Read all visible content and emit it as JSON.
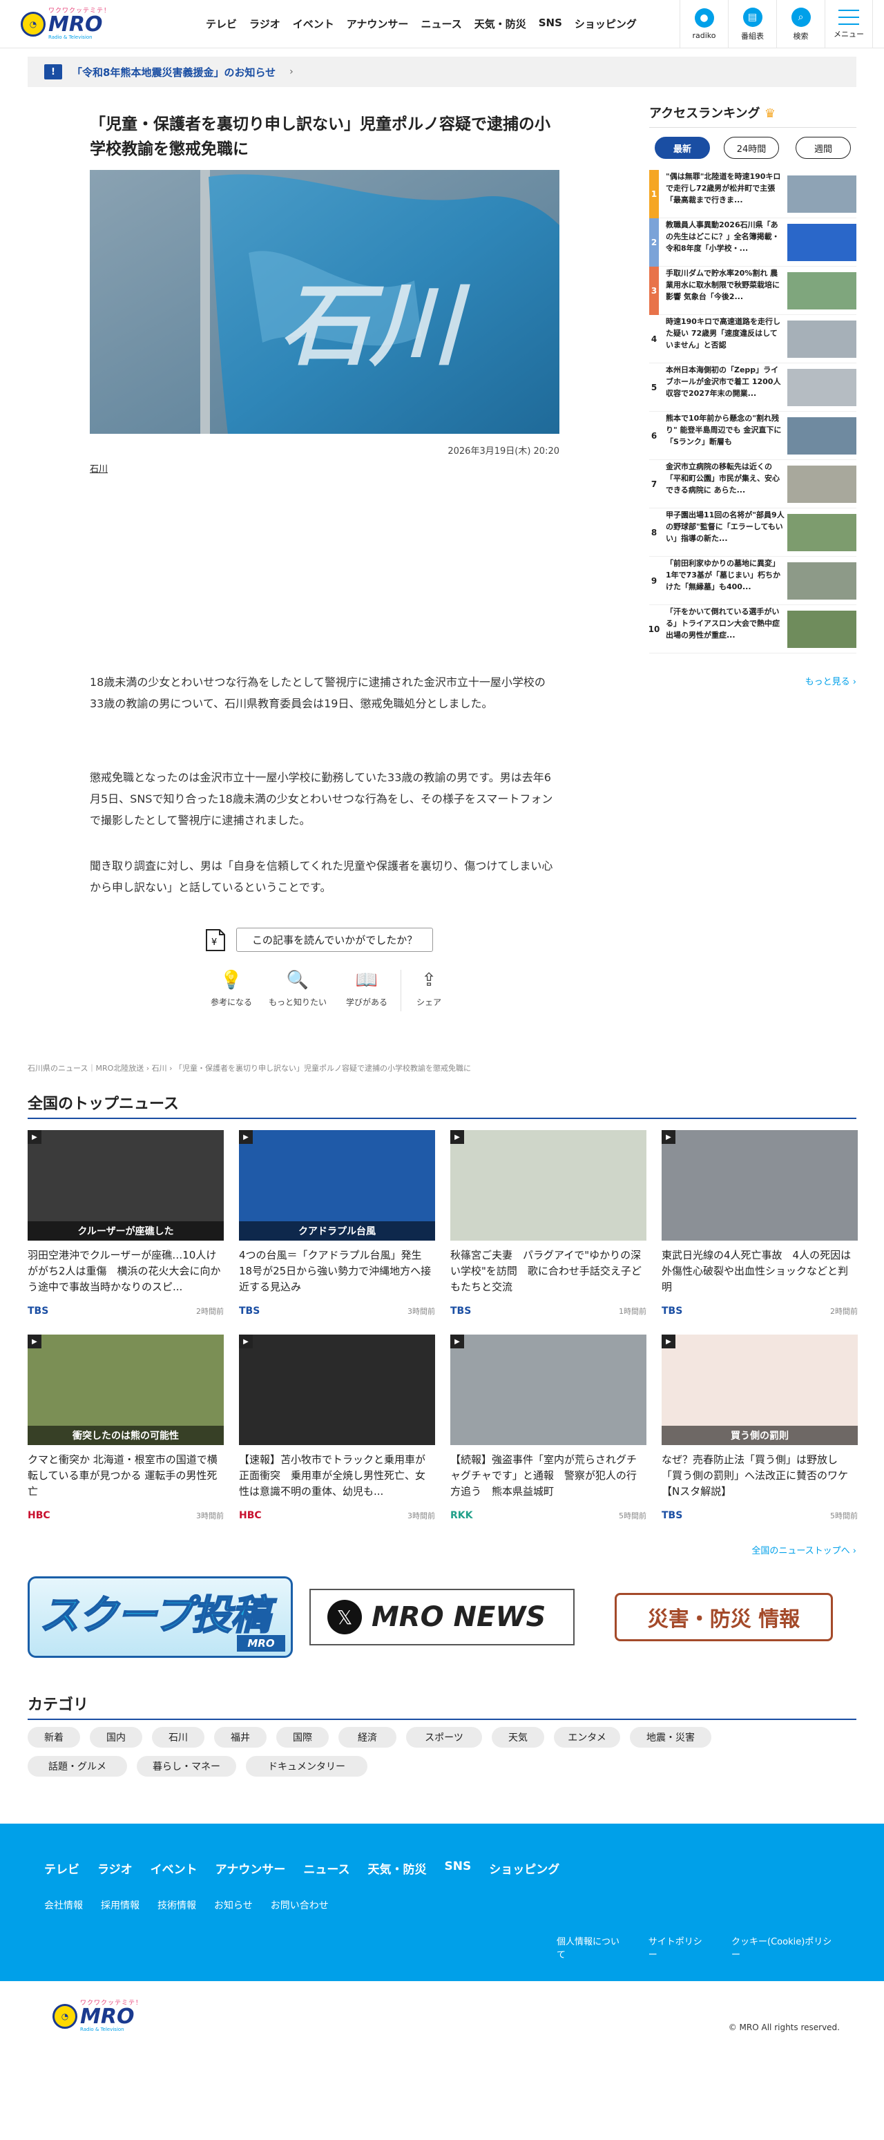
{
  "header": {
    "logo_kana": "ワクワクッテミテ！",
    "logo_text": "MRO",
    "logo_sub": "Radio & Television",
    "nav": [
      "テレビ",
      "ラジオ",
      "イベント",
      "アナウンサー",
      "ニュース",
      "天気・防災",
      "SNS",
      "ショッピング"
    ],
    "buttons": [
      {
        "label": "radiko",
        "icon": "radio-icon"
      },
      {
        "label": "番組表",
        "icon": "tv-guide-icon"
      },
      {
        "label": "検索",
        "icon": "search-icon"
      },
      {
        "label": "メニュー",
        "icon": "menu-icon"
      }
    ]
  },
  "notice": {
    "text": "「令和8年熊本地震災害義援金」のお知らせ",
    "arrow": "›"
  },
  "article": {
    "title": "「児童・保護者を裏切り申し訳ない」児童ポルノ容疑で逮捕の小学校教諭を懲戒免職に",
    "hero_text": "石川",
    "date": "2026年3月19日(木) 20:20",
    "tag": "石川",
    "paragraphs": [
      "18歳未満の少女とわいせつな行為をしたとして警視庁に逮捕された金沢市立十一屋小学校の33歳の教諭の男について、石川県教育委員会は19日、懲戒免職処分としました。",
      "懲戒免職となったのは金沢市立十一屋小学校に勤務していた33歳の教諭の男です。男は去年6月5日、SNSで知り合った18歳未満の少女とわいせつな行為をし、その様子をスマートフォンで撮影したとして警視庁に逮捕されました。",
      "聞き取り調査に対し、男は「自身を信頼してくれた児童や保護者を裏切り、傷つけてしまい心から申し訳ない」と話しているということです。"
    ],
    "feedback_question": "この記事を読んでいかがでしたか？",
    "feedback": [
      {
        "label": "参考になる",
        "icon": "lightbulb-icon",
        "glyph": "💡"
      },
      {
        "label": "もっと知りたい",
        "icon": "search-icon",
        "glyph": "🔍"
      },
      {
        "label": "学びがある",
        "icon": "book-icon",
        "glyph": "📖"
      },
      {
        "label": "シェア",
        "icon": "share-icon",
        "glyph": "⇪"
      }
    ]
  },
  "breadcrumb": "石川県のニュース｜MRO北陸放送 › 石川 › 「児童・保護者を裏切り申し訳ない」児童ポルノ容疑で逮捕の小学校教諭を懲戒免職に",
  "ranking": {
    "title": "アクセスランキング",
    "tabs": [
      "最新",
      "24時間",
      "週間"
    ],
    "items": [
      {
        "no": "1",
        "text": "\"偶は無罪\"北陸道を時速190キロで走行し72歳男が松井町で主張「最高裁まで行きま...",
        "color": "#f5a623"
      },
      {
        "no": "2",
        "text": "教職員人事異動2026石川県「あの先生はどこに？」全名簿掲載・令和8年度「小学校・...",
        "color": "#7ba3d8"
      },
      {
        "no": "3",
        "text": "手取川ダムで貯水率20%割れ 農業用水に取水制限で秋野菜栽培に影響 気象台「今後2...",
        "color": "#e8734a"
      },
      {
        "no": "4",
        "text": "時速190キロで高速道路を走行した疑い 72歳男「速度違反はしていません」と否認",
        "color": ""
      },
      {
        "no": "5",
        "text": "本州日本海側初の「Zepp」ライブホールが金沢市で着工 1200人収容で2027年末の開業...",
        "color": ""
      },
      {
        "no": "6",
        "text": "熊本で10年前から懸念の\"割れ残り\" 能登半島周辺でも 金沢直下に「Sランク」断層も",
        "color": ""
      },
      {
        "no": "7",
        "text": "金沢市立病院の移転先は近くの「平和町公園」市民が集え、安心できる病院に あらた...",
        "color": ""
      },
      {
        "no": "8",
        "text": "甲子園出場11回の名将が\"部員9人の野球部\"監督に「エラーしてもいい」指導の新た...",
        "color": ""
      },
      {
        "no": "9",
        "text": "「前田利家ゆかりの墓地に異変」1年で73基が「墓じまい」朽ちかけた「無縁墓」も400...",
        "color": ""
      },
      {
        "no": "10",
        "text": "「汗をかいて倒れている選手がいる」トライアスロン大会で熱中症 出場の男性が重症...",
        "color": ""
      }
    ],
    "more": "もっと見る ›"
  },
  "national": {
    "title": "全国のトップニュース",
    "items": [
      {
        "title": "羽田空港沖でクルーザーが座礁…10人けががち2人は重傷　横浜の花火大会に向かう途中で事故当時かなりのスピ...",
        "src": "TBS",
        "time": "2時間前",
        "caption": "クルーザーが座礁した"
      },
      {
        "title": "4つの台風＝「クアドラプル台風」発生 18号が25日から強い勢力で沖縄地方へ接近する見込み",
        "src": "TBS",
        "time": "3時間前",
        "caption": "クアドラプル台風"
      },
      {
        "title": "秋篠宮ご夫妻　パラグアイで\"ゆかりの深い学校\"を訪問　歌に合わせ手話交え子どもたちと交流",
        "src": "TBS",
        "time": "1時間前",
        "caption": ""
      },
      {
        "title": "東武日光線の4人死亡事故　4人の死因は外傷性心破裂や出血性ショックなどと判明",
        "src": "TBS",
        "time": "2時間前",
        "caption": ""
      },
      {
        "title": "クマと衝突か 北海道・根室市の国道で横転している車が見つかる 運転手の男性死亡",
        "src": "HBC",
        "time": "3時間前",
        "caption": "衝突したのは熊の可能性"
      },
      {
        "title": "【速報】苫小牧市でトラックと乗用車が正面衝突　乗用車が全焼し男性死亡、女性は意識不明の重体、幼児も...",
        "src": "HBC",
        "time": "3時間前",
        "caption": ""
      },
      {
        "title": "【続報】強盗事件「室内が荒らされグチャグチャです」と通報　警察が犯人の行方追う　熊本県益城町",
        "src": "RKK",
        "time": "5時間前",
        "caption": ""
      },
      {
        "title": "なぜ？売春防止法「買う側」は野放し「買う側の罰則」へ法改正に賛否のワケ【Nスタ解説】",
        "src": "TBS",
        "time": "5時間前",
        "caption": "買う側の罰則"
      }
    ],
    "more": "全国のニューストップへ ›"
  },
  "banners": {
    "scoop": "スクープ投稿",
    "scoop_sub": "MRO",
    "x_news": "MRO NEWS",
    "x_logo": "𝕏",
    "disaster": "災害・防災 情報"
  },
  "category": {
    "title": "カテゴリ",
    "items": [
      "新着",
      "国内",
      "石川",
      "福井",
      "国際",
      "経済",
      "スポーツ",
      "天気",
      "エンタメ",
      "地震・災害",
      "話題・グルメ",
      "暮らし・マネー",
      "ドキュメンタリー"
    ]
  },
  "footer": {
    "nav": [
      "テレビ",
      "ラジオ",
      "イベント",
      "アナウンサー",
      "ニュース",
      "天気・防災",
      "SNS",
      "ショッピング"
    ],
    "sub": [
      "会社情報",
      "採用情報",
      "技術情報",
      "お知らせ",
      "お問い合わせ"
    ],
    "policy": [
      "個人情報について",
      "サイトポリシー",
      "クッキー(Cookie)ポリシー"
    ],
    "copyright": "© MRO All rights reserved."
  },
  "colors": {
    "accent": "#00a0e9",
    "navy": "#1a4ea3",
    "tbs": "#1a4ea3",
    "hbc": "#c8102e",
    "rkk": "#21a08a"
  }
}
